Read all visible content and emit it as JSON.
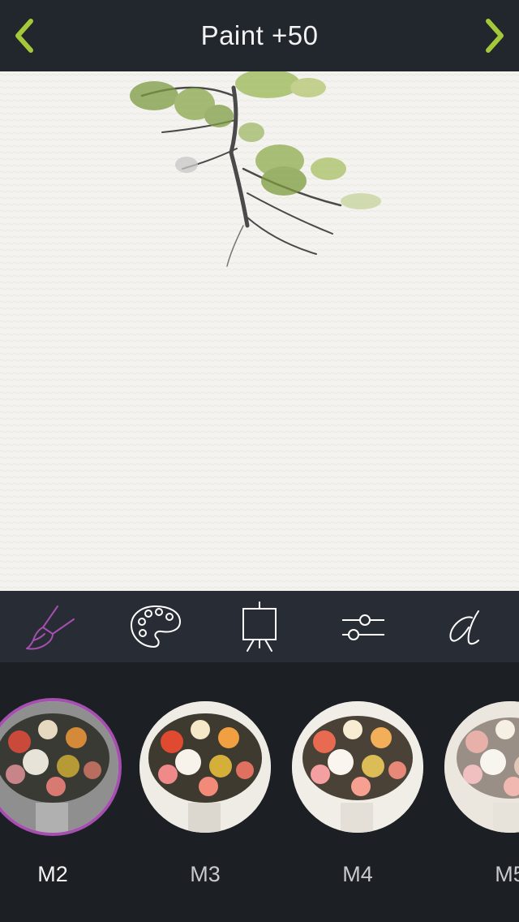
{
  "header": {
    "title": "Paint +50"
  },
  "colors": {
    "accent": "#a3c93a",
    "selected": "#a64fb0",
    "bar": "#22262d"
  },
  "toolbar": {
    "tools": [
      {
        "icon": "brush-icon",
        "selected": true
      },
      {
        "icon": "palette-icon",
        "selected": false
      },
      {
        "icon": "easel-icon",
        "selected": false
      },
      {
        "icon": "sliders-icon",
        "selected": false
      },
      {
        "icon": "text-style-icon",
        "selected": false
      }
    ]
  },
  "presets": [
    {
      "label": "M2",
      "selected": true
    },
    {
      "label": "M3",
      "selected": false
    },
    {
      "label": "M4",
      "selected": false
    },
    {
      "label": "M5",
      "selected": false
    }
  ]
}
